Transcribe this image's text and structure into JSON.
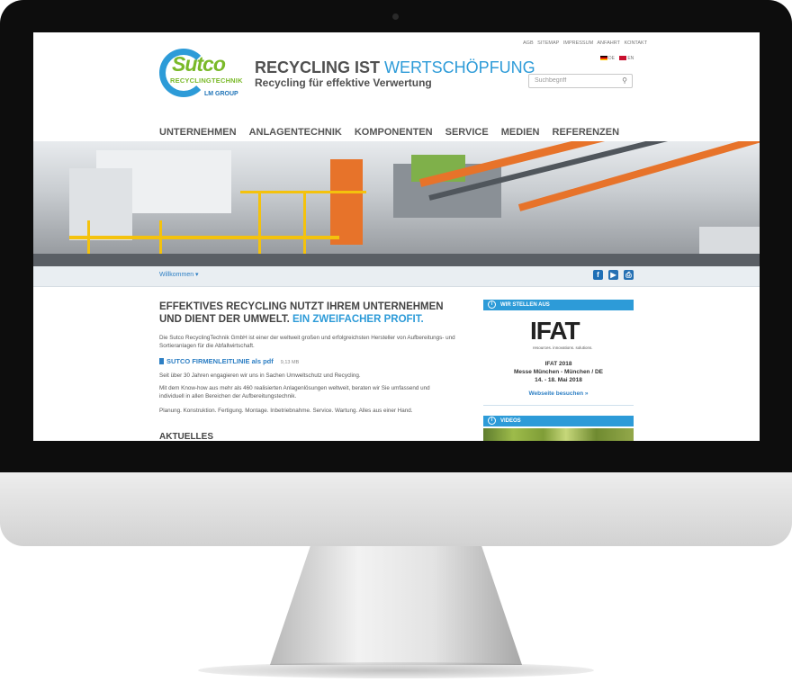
{
  "header": {
    "logo": {
      "word": "Sutco",
      "sub": "RECYCLINGTECHNIK",
      "group": "LM GROUP"
    },
    "tagline_main": "RECYCLING IST ",
    "tagline_highlight": "WERTSCHÖPFUNG",
    "tagline_sub": "Recycling für effektive Verwertung",
    "top_links": [
      "AGB",
      "SITEMAP",
      "IMPRESSUM",
      "ANFAHRT",
      "KONTAKT"
    ],
    "languages": [
      "DE",
      "EN"
    ],
    "search_placeholder": "Suchbegriff"
  },
  "nav": [
    "UNTERNEHMEN",
    "ANLAGENTECHNIK",
    "KOMPONENTEN",
    "SERVICE",
    "MEDIEN",
    "REFERENZEN"
  ],
  "breadcrumb": "Willkommen ▾",
  "social_icons": [
    "facebook-icon",
    "youtube-icon",
    "print-icon"
  ],
  "main": {
    "headline": "EFFEKTIVES RECYCLING NUTZT IHREM UNTERNEHMEN UND DIENT DER UMWELT. ",
    "headline_highlight": "EIN ZWEIFACHER PROFIT.",
    "intro": "Die Sutco RecyclingTechnik GmbH ist einer der weltweit großen und erfolgreichsten Hersteller von Aufbereitungs- und Sortieranlagen für die Abfallwirtschaft.",
    "pdf_label": "SUTCO FIRMENLEITLINIE als pdf",
    "pdf_size": "9,13 MB",
    "para1": "Seit über 30 Jahren engagieren wir uns in Sachen Umweltschutz und Recycling.",
    "para2": "Mit dem Know-how aus mehr als 460 realisierten Anlagenlösungen weltweit, beraten wir Sie umfassend und individuell in allen Bereichen der Aufbereitungstechnik.",
    "para3": "Planung. Konstruktion. Fertigung. Montage. Inbetriebnahme. Service. Wartung. Alles aus einer Hand.",
    "news_heading": "AKTUELLES"
  },
  "sidebar": {
    "exhibit_heading": "WIR STELLEN AUS",
    "ifat_logo": "IFAT",
    "ifat_claim": "resources. innovations. solutions.",
    "event_title": "IFAT 2018",
    "event_location": "Messe München - München / DE",
    "event_date": "14. - 18. Mai 2018",
    "event_link": "Webseite besuchen »",
    "videos_heading": "VIDEOS"
  },
  "colors": {
    "accent": "#2d9bd8",
    "logo_green": "#7ab929",
    "nav_text": "#555555"
  }
}
